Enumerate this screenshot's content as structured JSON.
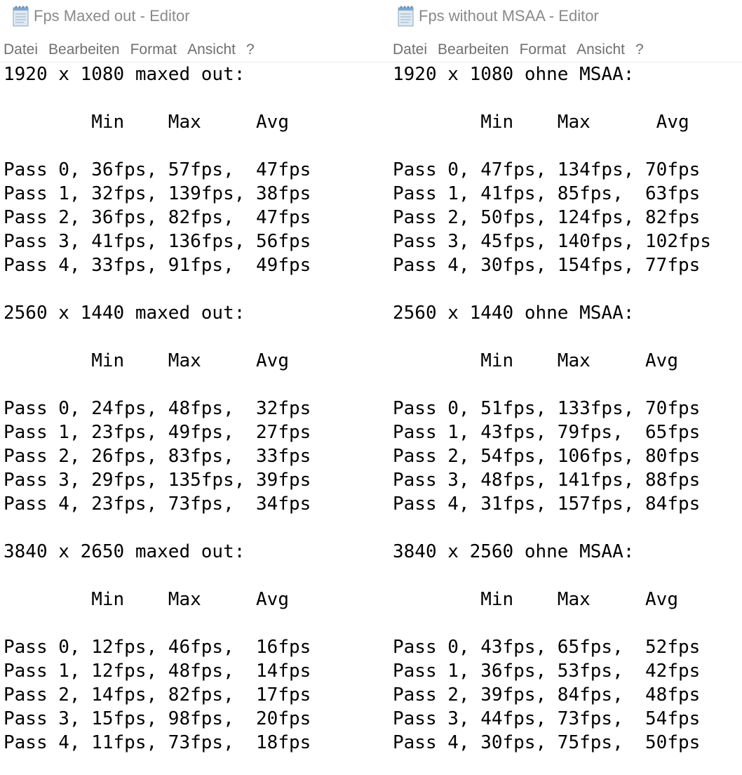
{
  "windows": [
    {
      "title": "Fps Maxed out - Editor",
      "menu": [
        "Datei",
        "Bearbeiten",
        "Format",
        "Ansicht",
        "?"
      ],
      "text": "1920 x 1080 maxed out:\n\n        Min    Max     Avg\n\nPass 0, 36fps, 57fps,  47fps\nPass 1, 32fps, 139fps, 38fps\nPass 2, 36fps, 82fps,  47fps\nPass 3, 41fps, 136fps, 56fps\nPass 4, 33fps, 91fps,  49fps\n\n2560 x 1440 maxed out:\n\n        Min    Max     Avg\n\nPass 0, 24fps, 48fps,  32fps\nPass 1, 23fps, 49fps,  27fps\nPass 2, 26fps, 83fps,  33fps\nPass 3, 29fps, 135fps, 39fps\nPass 4, 23fps, 73fps,  34fps\n\n3840 x 2650 maxed out:\n\n        Min    Max     Avg\n\nPass 0, 12fps, 46fps,  16fps\nPass 1, 12fps, 48fps,  14fps\nPass 2, 14fps, 82fps,  17fps\nPass 3, 15fps, 98fps,  20fps\nPass 4, 11fps, 73fps,  18fps"
    },
    {
      "title": "Fps without MSAA - Editor",
      "menu": [
        "Datei",
        "Bearbeiten",
        "Format",
        "Ansicht",
        "?"
      ],
      "text": "1920 x 1080 ohne MSAA:\n\n        Min    Max      Avg\n\nPass 0, 47fps, 134fps, 70fps\nPass 1, 41fps, 85fps,  63fps\nPass 2, 50fps, 124fps, 82fps\nPass 3, 45fps, 140fps, 102fps\nPass 4, 30fps, 154fps, 77fps\n\n2560 x 1440 ohne MSAA:\n\n        Min    Max     Avg\n\nPass 0, 51fps, 133fps, 70fps\nPass 1, 43fps, 79fps,  65fps\nPass 2, 54fps, 106fps, 80fps\nPass 3, 48fps, 141fps, 88fps\nPass 4, 31fps, 157fps, 84fps\n\n3840 x 2560 ohne MSAA:\n\n        Min    Max     Avg\n\nPass 0, 43fps, 65fps,  52fps\nPass 1, 36fps, 53fps,  42fps\nPass 2, 39fps, 84fps,  48fps\nPass 3, 44fps, 73fps,  54fps\nPass 4, 30fps, 75fps,  50fps"
    }
  ],
  "icons": {
    "app_icon": "notepad-icon"
  }
}
